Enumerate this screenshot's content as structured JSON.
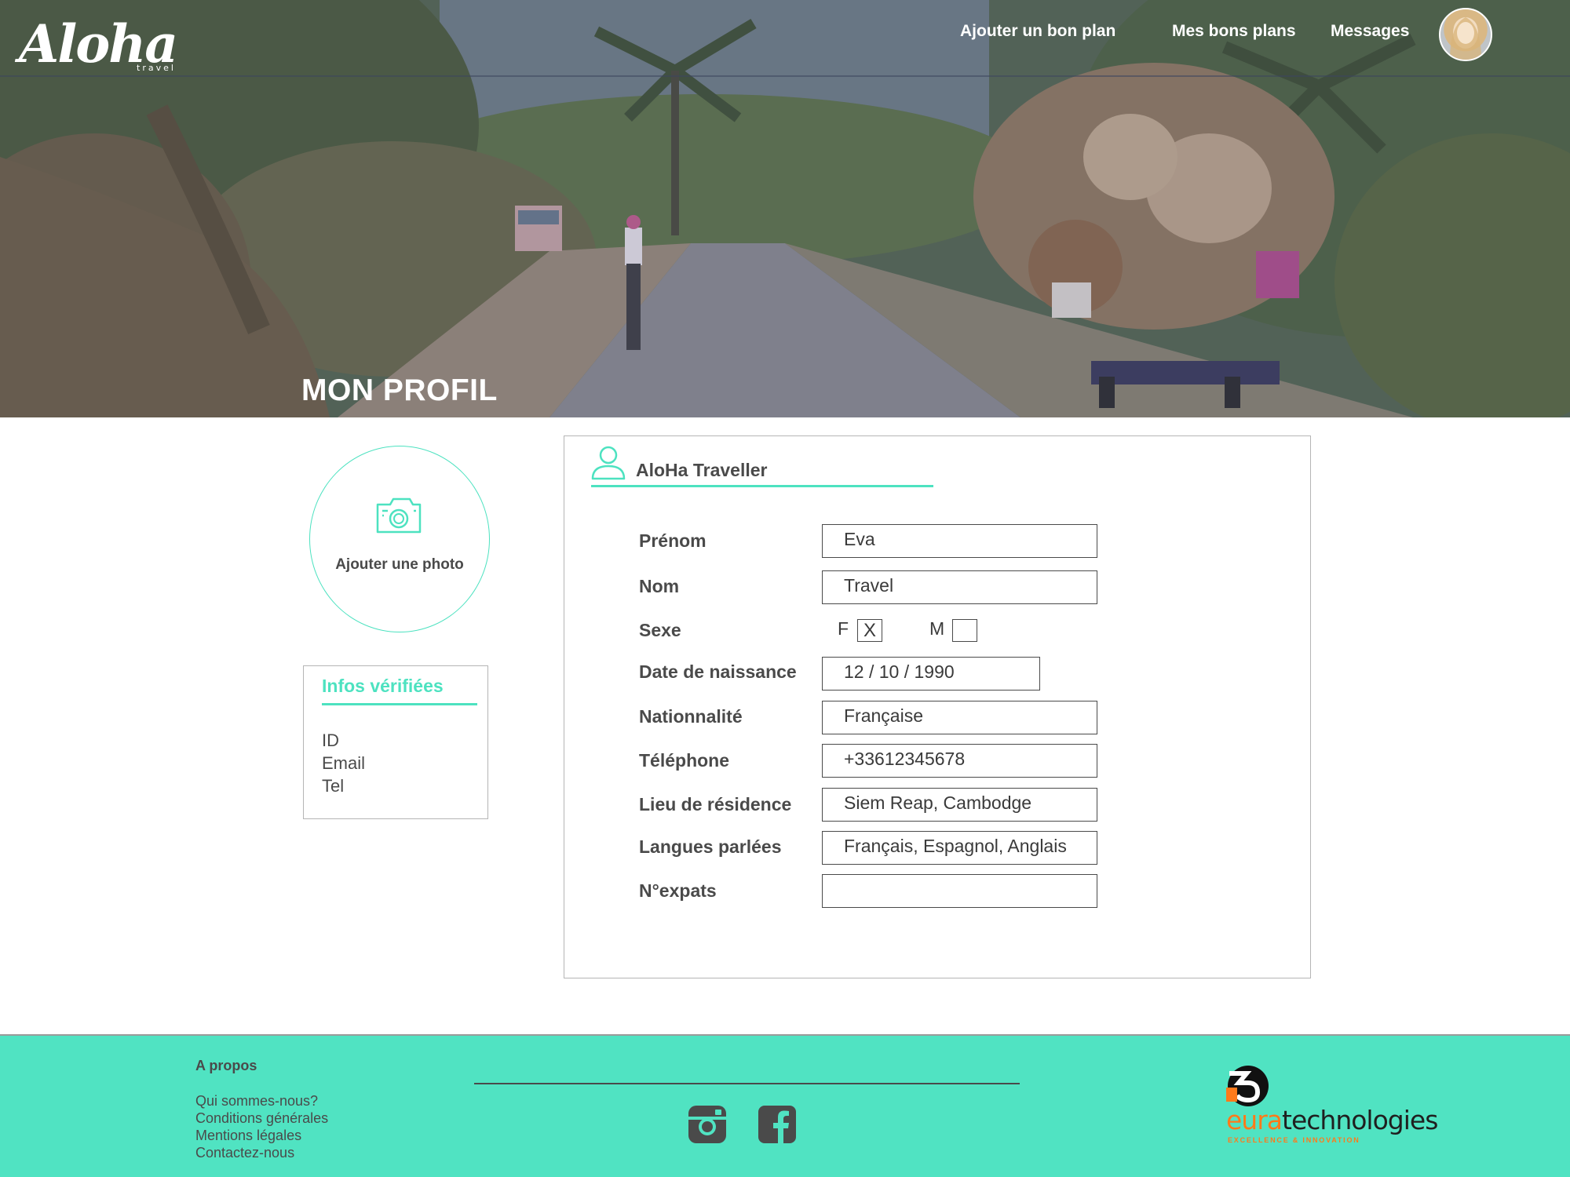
{
  "brand": {
    "logo_text": "Aloha",
    "logo_subtext": "travel"
  },
  "nav": {
    "items": [
      {
        "label": "Ajouter un bon plan"
      },
      {
        "label": "Mes bons plans"
      },
      {
        "label": "Messages"
      }
    ]
  },
  "hero": {
    "title": "MON PROFIL"
  },
  "photo": {
    "label": "Ajouter une photo",
    "icon": "camera-icon"
  },
  "verified": {
    "title": "Infos vérifiées",
    "items": [
      "ID",
      "Email",
      "Tel"
    ]
  },
  "profile": {
    "username": "AloHa Traveller",
    "icon": "user-icon",
    "fields": {
      "first_name": {
        "label": "Prénom",
        "value": "Eva"
      },
      "last_name": {
        "label": "Nom",
        "value": "Travel"
      },
      "sex": {
        "label": "Sexe",
        "option_f": "F",
        "option_m": "M",
        "f_mark": "X",
        "m_mark": ""
      },
      "birth_date": {
        "label": "Date de naissance",
        "value": "12 / 10 / 1990"
      },
      "nationality": {
        "label": "Nationnalité",
        "value": "Française"
      },
      "phone": {
        "label": "Téléphone",
        "value": "+33612345678"
      },
      "residence": {
        "label": "Lieu de résidence",
        "value": "Siem Reap, Cambodge"
      },
      "languages": {
        "label": "Langues parlées",
        "value": "Français, Espagnol, Anglais"
      },
      "expats": {
        "label": "N°expats",
        "value": ""
      }
    }
  },
  "footer": {
    "about_title": "A propos",
    "links": [
      "Qui sommes-nous?",
      "Conditions générales",
      "Mentions légales",
      "Contactez-nous"
    ],
    "partner": {
      "prefix": "eura",
      "suffix": "technologies",
      "tagline": "EXCELLENCE & INNOVATION"
    }
  },
  "colors": {
    "accent": "#50e3c2",
    "text": "#4a4a4a",
    "partner_orange": "#ff7a1a"
  }
}
